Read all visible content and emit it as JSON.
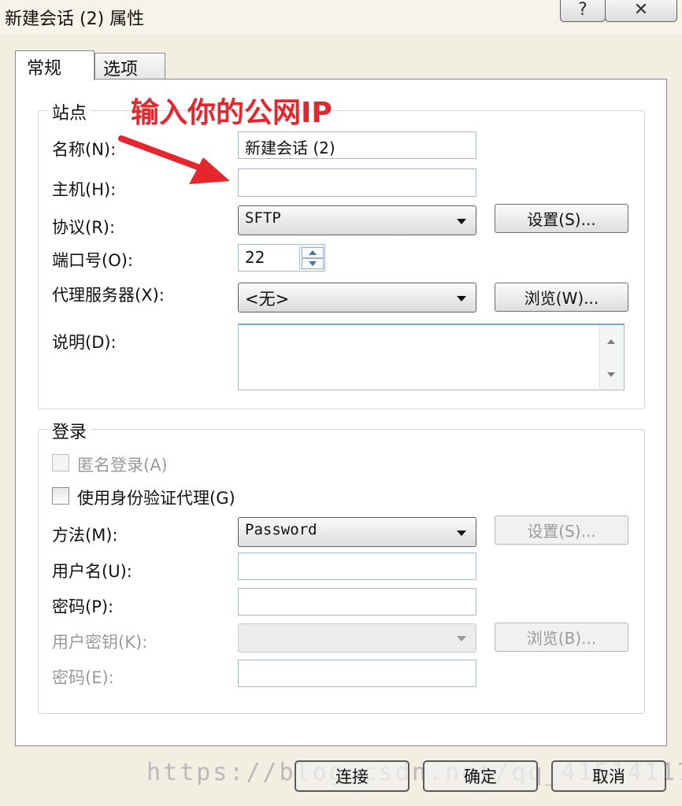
{
  "window": {
    "title": "新建会话 (2) 属性",
    "help": "?",
    "close": "✕"
  },
  "tabs": [
    {
      "label": "常规"
    },
    {
      "label": "选项"
    }
  ],
  "annotation": {
    "text": "输入你的公网IP",
    "color": "#e5262d"
  },
  "site": {
    "group_label": "站点",
    "name_label": "名称(N):",
    "name_value": "新建会话 (2)",
    "host_label": "主机(H):",
    "host_value": "",
    "protocol_label": "协议(R):",
    "protocol_value": "SFTP",
    "settings_button": "设置(S)...",
    "port_label": "端口号(O):",
    "port_value": "22",
    "proxy_label": "代理服务器(X):",
    "proxy_value": "<无>",
    "browse_button": "浏览(W)...",
    "desc_label": "说明(D):",
    "desc_value": ""
  },
  "login": {
    "group_label": "登录",
    "anonymous_label": "匿名登录(A)",
    "agent_label": "使用身份验证代理(G)",
    "method_label": "方法(M):",
    "method_value": "Password",
    "method_settings_button": "设置(S)...",
    "username_label": "用户名(U):",
    "username_value": "",
    "password_label": "密码(P):",
    "password_value": "",
    "userkey_label": "用户密钥(K):",
    "userkey_value": "",
    "key_browse_button": "浏览(B)...",
    "passphrase_label": "密码(E):",
    "passphrase_value": ""
  },
  "footer": {
    "connect_button": "连接",
    "ok_button": "确定",
    "cancel_button": "取消",
    "watermark": "https://blog.csdn.net/qq_41514117"
  }
}
